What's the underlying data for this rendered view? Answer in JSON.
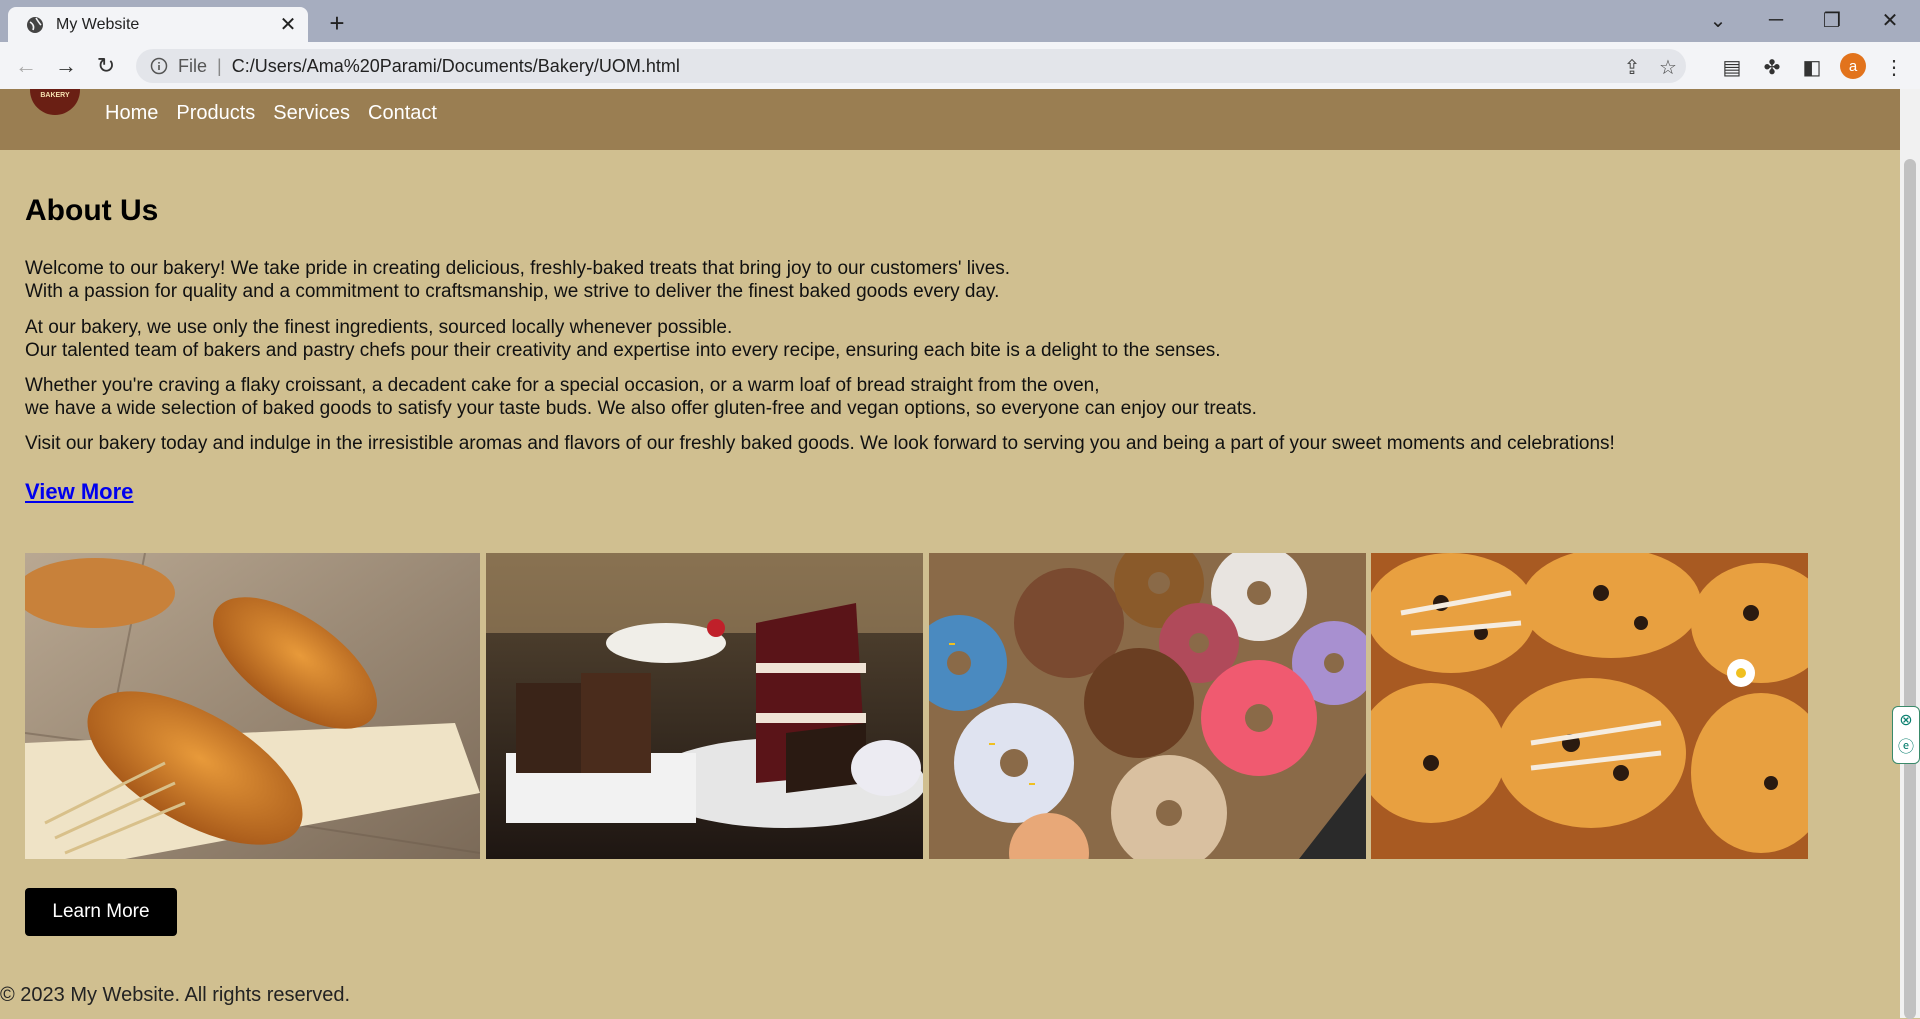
{
  "browser": {
    "tab_title": "My Website",
    "tab_close": "✕",
    "new_tab": "+",
    "address_scheme": "File",
    "address_separator": "|",
    "url": "C:/Users/Ama%20Parami/Documents/Bakery/UOM.html",
    "profile_initial": "a"
  },
  "site": {
    "logo_text": "BAKERY",
    "nav": [
      "Home",
      "Products",
      "Services",
      "Contact"
    ],
    "about": {
      "heading": "About Us",
      "p1_line1": "Welcome to our bakery! We take pride in creating delicious, freshly-baked treats that bring joy to our customers' lives.",
      "p1_line2": "With a passion for quality and a commitment to craftsmanship, we strive to deliver the finest baked goods every day.",
      "p2_line1": "At our bakery, we use only the finest ingredients, sourced locally whenever possible.",
      "p2_line2": "Our talented team of bakers and pastry chefs pour their creativity and expertise into every recipe, ensuring each bite is a delight to the senses.",
      "p3_line1": "Whether you're craving a flaky croissant, a decadent cake for a special occasion, or a warm loaf of bread straight from the oven,",
      "p3_line2": "we have a wide selection of baked goods to satisfy your taste buds. We also offer gluten-free and vegan options, so everyone can enjoy our treats.",
      "p4": "Visit our bakery today and indulge in the irresistible aromas and flavors of our freshly baked goods. We look forward to serving you and being a part of your sweet moments and celebrations!",
      "view_more": "View More"
    },
    "learn_more": "Learn More",
    "footer": "© 2023 My Website. All rights reserved."
  },
  "colors": {
    "page_bg": "#d0bf90",
    "nav_bg": "#9a7e52",
    "link": "#0000ee",
    "button_bg": "#000000"
  }
}
